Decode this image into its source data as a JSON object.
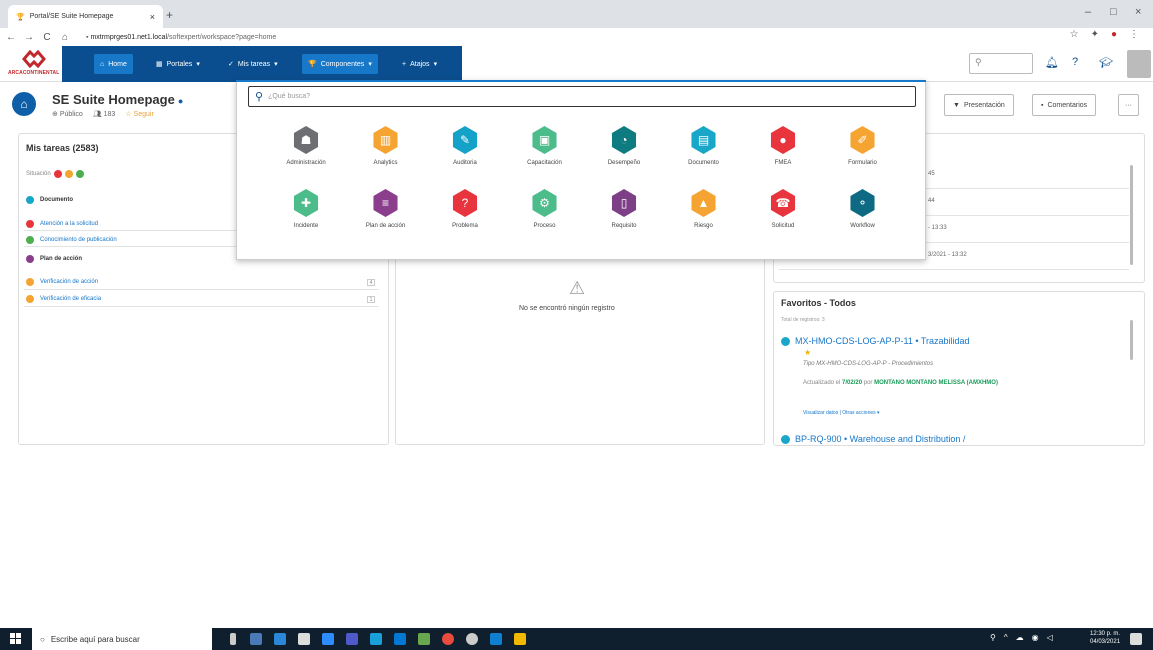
{
  "browser": {
    "tab_title": "Portal/SE Suite Homepage",
    "tab_close": "×",
    "new_tab": "+",
    "url_host": "mxtrmprges01.net1.local",
    "url_path": "/softexpert/workspace?page=home",
    "window_controls": [
      "–",
      "□",
      "×"
    ]
  },
  "brand": {
    "logo_text": "ARCACONTINENTAL",
    "color": "#c0282d"
  },
  "nav": {
    "home": "Home",
    "portales": "Portales",
    "mis_tareas": "Mis tareas",
    "componentes": "Componentes",
    "atajos": "Atajos",
    "bar_color": "#0b4e8f",
    "active_color": "#1777c8"
  },
  "header_icons": [
    "search-icon",
    "bell-icon",
    "help-icon",
    "graduation-icon",
    "user-avatar"
  ],
  "page": {
    "title": "SE Suite Homepage",
    "visibility": "Público",
    "followers": "183",
    "follow": "Seguir",
    "presentacion": "Presentación",
    "comentarios": "Comentarios",
    "more": "···"
  },
  "mis_tareas": {
    "title": "Mis tareas (2583)",
    "situacion": "Situación",
    "groups": [
      {
        "label": "Documento",
        "items": [
          "Atención a la solicitud",
          "Conocimiento de publicación"
        ]
      },
      {
        "label": "Plan de acción",
        "items": [
          "Verificación de acción",
          "Verificación de eficacia"
        ]
      }
    ],
    "counts": [
      "4",
      "1"
    ]
  },
  "middle": {
    "empty": "No se encontró ningún registro"
  },
  "right_top": {
    "times": [
      "45",
      "44",
      "- 13:33",
      "3/2021 - 13:32"
    ]
  },
  "favoritos": {
    "title": "Favoritos - Todos",
    "total": "Total de registros: 3",
    "item1_title": "MX-HMO-CDS-LOG-AP-P-11 • Trazabilidad",
    "item1_type": "Tipo MX-HMO-CDS-LOG-AP-P - Procedimientos",
    "item1_updated_prefix": "Actualizado el",
    "item1_date": "7/02/20",
    "item1_by": "por",
    "item1_author": "MONTANO MONTANO MELISSA (AMXHMO)",
    "item1_actions": "Visualizar datos  |  Otras acciones ▾",
    "item2_title": "BP-RQ-900 • Warehouse and Distribution /"
  },
  "componentes_menu": {
    "search_placeholder": "¿Qué busca?",
    "modules": [
      {
        "label": "Administración",
        "icon": "admin-icon",
        "color": "#6d6e71"
      },
      {
        "label": "Analytics",
        "icon": "analytics-icon",
        "color": "#f5a431"
      },
      {
        "label": "Auditoria",
        "icon": "audit-icon",
        "color": "#14a2c9"
      },
      {
        "label": "Capacitación",
        "icon": "training-icon",
        "color": "#4cbc8a"
      },
      {
        "label": "Desempeño",
        "icon": "performance-icon",
        "color": "#0d7b7f"
      },
      {
        "label": "Documento",
        "icon": "document-icon",
        "color": "#18a7c9"
      },
      {
        "label": "FMEA",
        "icon": "fmea-icon",
        "color": "#e8343c"
      },
      {
        "label": "Formulario",
        "icon": "form-icon",
        "color": "#f5a431"
      },
      {
        "label": "Incidente",
        "icon": "incident-icon",
        "color": "#4cbc8a"
      },
      {
        "label": "Plan de acción",
        "icon": "action-plan-icon",
        "color": "#8a3e8c"
      },
      {
        "label": "Problema",
        "icon": "problem-icon",
        "color": "#e8343c"
      },
      {
        "label": "Proceso",
        "icon": "process-icon",
        "color": "#4cbc8a"
      },
      {
        "label": "Requisito",
        "icon": "requirement-icon",
        "color": "#7d3f86"
      },
      {
        "label": "Riesgo",
        "icon": "risk-icon",
        "color": "#f5a431"
      },
      {
        "label": "Solicitud",
        "icon": "request-icon",
        "color": "#e8343c"
      },
      {
        "label": "Workflow",
        "icon": "workflow-icon",
        "color": "#0d6a82"
      }
    ]
  },
  "taskbar": {
    "search": "Escribe aquí para buscar",
    "time": "12:30 p. m.",
    "date": "04/03/2021"
  }
}
